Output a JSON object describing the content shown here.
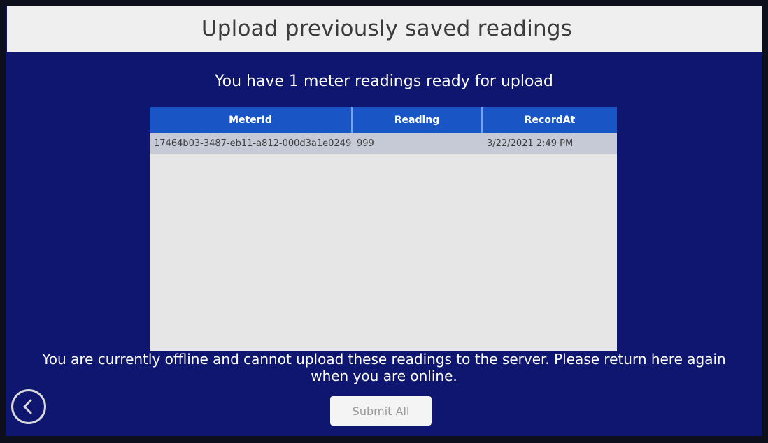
{
  "header": {
    "title": "Upload previously saved readings"
  },
  "summary": {
    "text": "You have 1 meter readings ready for upload"
  },
  "table": {
    "columns": [
      "MeterId",
      "Reading",
      "RecordAt"
    ],
    "rows": [
      {
        "meter_id": "17464b03-3487-eb11-a812-000d3a1e0249",
        "reading": "999",
        "record_at": "3/22/2021 2:49 PM"
      }
    ]
  },
  "status": {
    "offline_message": "You are currently offline and cannot upload these readings to the server. Please return here again when you are online."
  },
  "actions": {
    "submit_label": "Submit All",
    "back_icon": "chevron-left-circle-icon"
  },
  "colors": {
    "background": "#0f1670",
    "header_bar": "#efefef",
    "table_header": "#1a55c6",
    "selected_row": "#c5cad6"
  }
}
